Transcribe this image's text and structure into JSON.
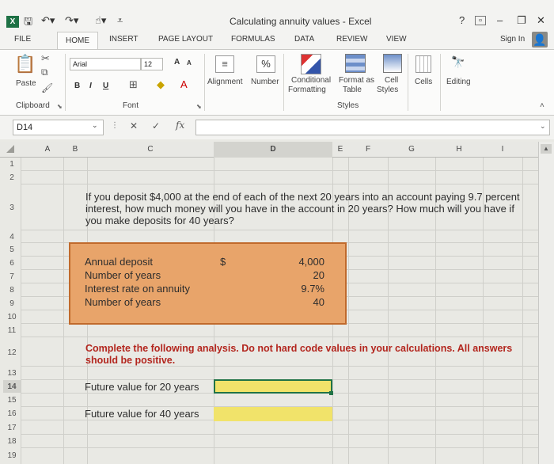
{
  "app": {
    "logo": "X",
    "title": "Calculating annuity values - Excel",
    "sign_in": "Sign In",
    "help": "?",
    "minimize": "–",
    "restore": "❐",
    "close": "✕"
  },
  "tabs": [
    "FILE",
    "HOME",
    "INSERT",
    "PAGE LAYOUT",
    "FORMULAS",
    "DATA",
    "REVIEW",
    "VIEW"
  ],
  "ribbon": {
    "paste": "Paste",
    "clipboard": "Clipboard",
    "font_name": "Arial",
    "font_size": "12",
    "grow_font": "A",
    "shrink_font": "A",
    "bold": "B",
    "italic": "I",
    "underline": "U",
    "font_group": "Font",
    "alignment": "Alignment",
    "number": "Number",
    "number_symbol": "%",
    "conditional_formatting_1": "Conditional",
    "conditional_formatting_2": "Formatting",
    "format_as_table_1": "Format as",
    "format_as_table_2": "Table",
    "cell_styles_1": "Cell",
    "cell_styles_2": "Styles",
    "styles_group": "Styles",
    "cells": "Cells",
    "editing": "Editing"
  },
  "formula_bar": {
    "name_box": "D14",
    "cancel": "✕",
    "enter": "✓",
    "fx": "fx",
    "value": ""
  },
  "columns": [
    "A",
    "B",
    "C",
    "D",
    "E",
    "F",
    "G",
    "H",
    "I"
  ],
  "rows": [
    "1",
    "2",
    "3",
    "4",
    "5",
    "6",
    "7",
    "8",
    "9",
    "10",
    "11",
    "12",
    "13",
    "14",
    "15",
    "16",
    "17",
    "18",
    "19"
  ],
  "sheet": {
    "prompt": "If you deposit $4,000 at the end of each of the next 20 years into an account paying 9.7 percent interest, how much money will you have in the account in 20 years? How much will you have if you make deposits for 40 years?",
    "inputs": [
      {
        "label": "Annual deposit",
        "value": "4,000"
      },
      {
        "label": "Number of years",
        "value": "20"
      },
      {
        "label": "Interest rate on annuity",
        "value": "9.7%"
      },
      {
        "label": "Number of years",
        "value": "40"
      }
    ],
    "dollar_sign": "$",
    "instruction": "Complete the following analysis. Do not hard code values in your calculations. All answers should be positive.",
    "fv20_label": "Future value for 20 years",
    "fv20_value": "",
    "fv40_label": "Future value for 40 years",
    "fv40_value": ""
  },
  "colors": {
    "excel_green": "#1e7145",
    "input_fill": "#e8a46a",
    "input_border": "#c06a2c",
    "answer_fill": "#f1e36a",
    "instruction_red": "#b3261e"
  }
}
